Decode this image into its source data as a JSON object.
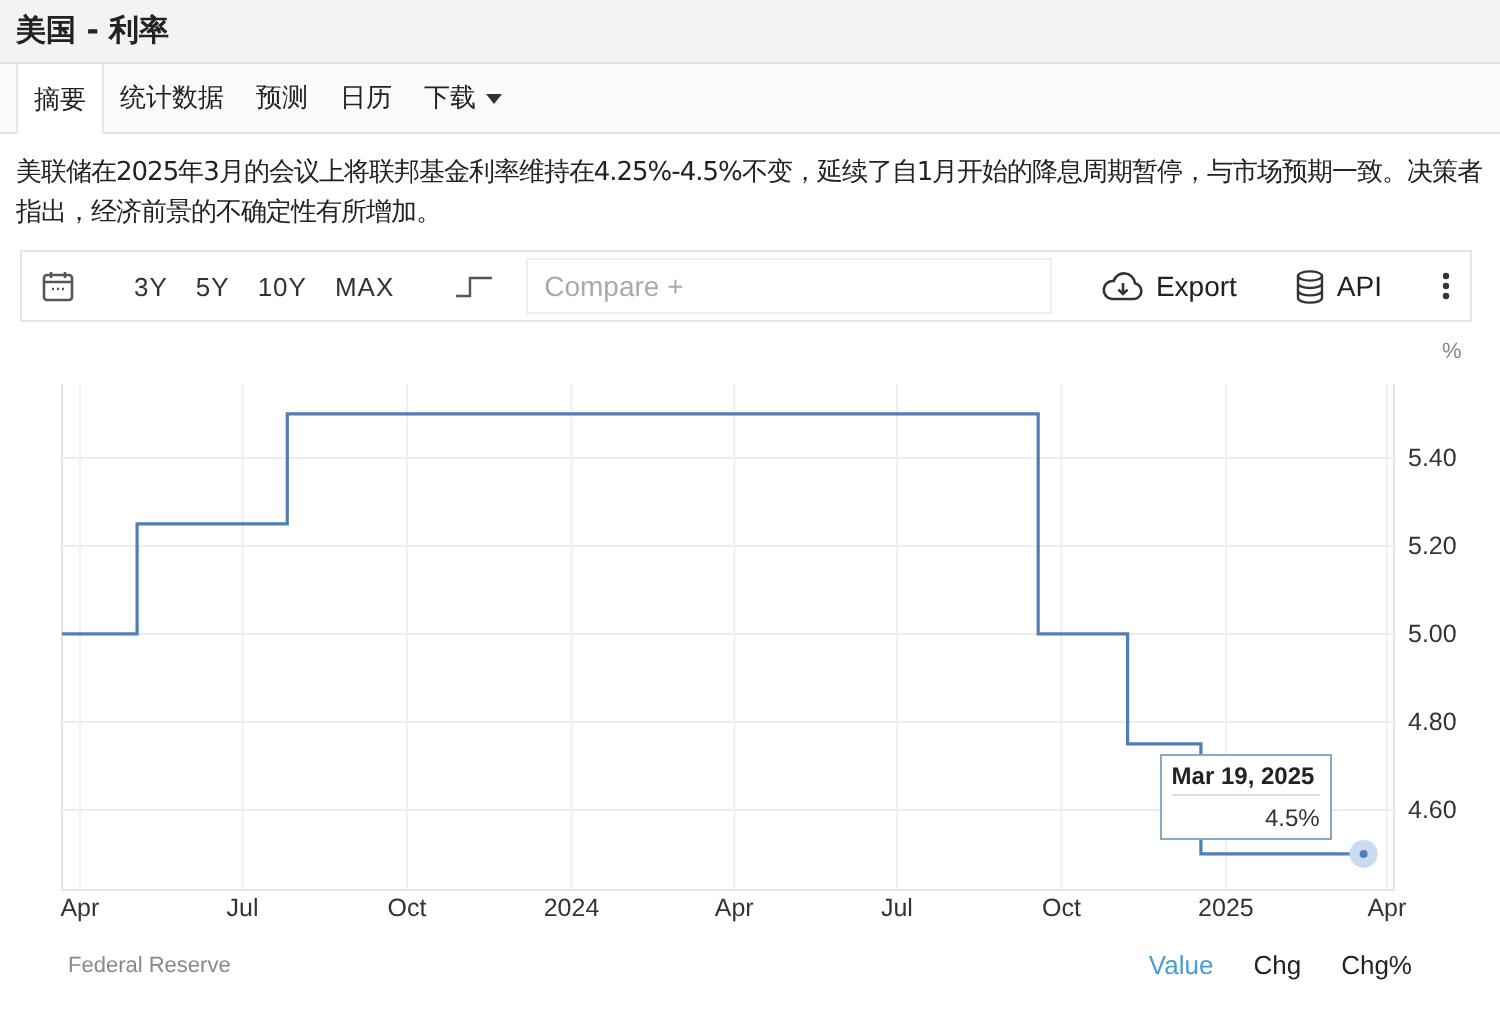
{
  "header": {
    "title": "美国 - 利率"
  },
  "tabs": [
    {
      "label": "摘要",
      "selected": true
    },
    {
      "label": "统计数据",
      "selected": false
    },
    {
      "label": "预测",
      "selected": false
    },
    {
      "label": "日历",
      "selected": false
    },
    {
      "label": "下载",
      "selected": false,
      "kind": "dropdown"
    }
  ],
  "summary": "美联储在2025年3月的会议上将联邦基金利率维持在4.25%-4.5%不变，延续了自1月开始的降息周期暂停，与市场预期一致。决策者指出，经济前景的不确定性有所增加。",
  "toolbar": {
    "ranges": [
      {
        "label": "3Y",
        "selected": false
      },
      {
        "label": "5Y",
        "selected": false
      },
      {
        "label": "10Y",
        "selected": false
      },
      {
        "label": "MAX",
        "selected": false
      }
    ],
    "compare": {
      "placeholder": "Compare +"
    },
    "export": "Export",
    "api": "API"
  },
  "chart": {
    "chart_data": {
      "type": "line",
      "ylabel": "%",
      "x": [
        "2023-03-22",
        "2023-05-03",
        "2023-05-03",
        "2023-07-26",
        "2023-07-26",
        "2024-09-18",
        "2024-09-18",
        "2024-11-07",
        "2024-11-07",
        "2024-12-18",
        "2024-12-18",
        "2025-03-19"
      ],
      "series": [
        {
          "color": "#4f7fb5",
          "values": [
            5.0,
            5.0,
            5.25,
            5.25,
            5.5,
            5.5,
            5.0,
            5.0,
            4.75,
            4.75,
            4.5,
            4.5
          ]
        }
      ],
      "grid": true,
      "xlim": [
        "2023-03-22",
        "2025-04-05"
      ],
      "ylim": [
        4.418,
        5.568
      ],
      "xticks": [
        {
          "value": "2023-04-01",
          "label": "Apr"
        },
        {
          "value": "2023-07-01",
          "label": "Jul"
        },
        {
          "value": "2023-10-01",
          "label": "Oct"
        },
        {
          "value": "2024-01-01",
          "label": "2024"
        },
        {
          "value": "2024-04-01",
          "label": "Apr"
        },
        {
          "value": "2024-07-01",
          "label": "Jul"
        },
        {
          "value": "2024-10-01",
          "label": "Oct"
        },
        {
          "value": "2025-01-01",
          "label": "2025"
        },
        {
          "value": "2025-04-01",
          "label": "Apr"
        }
      ],
      "yticks": [
        {
          "value": 4.6,
          "label": "4.60"
        },
        {
          "value": 4.8,
          "label": "4.80"
        },
        {
          "value": 5.0,
          "label": "5.00"
        },
        {
          "value": 5.2,
          "label": "5.20"
        },
        {
          "value": 5.4,
          "label": "5.40"
        }
      ]
    },
    "tooltip": {
      "date": "Mar 19, 2025",
      "value": "4.5%"
    }
  },
  "footer": {
    "source": "Federal Reserve",
    "modes": [
      {
        "label": "Value",
        "selected": true
      },
      {
        "label": "Chg",
        "selected": false
      },
      {
        "label": "Chg%",
        "selected": false
      }
    ]
  }
}
